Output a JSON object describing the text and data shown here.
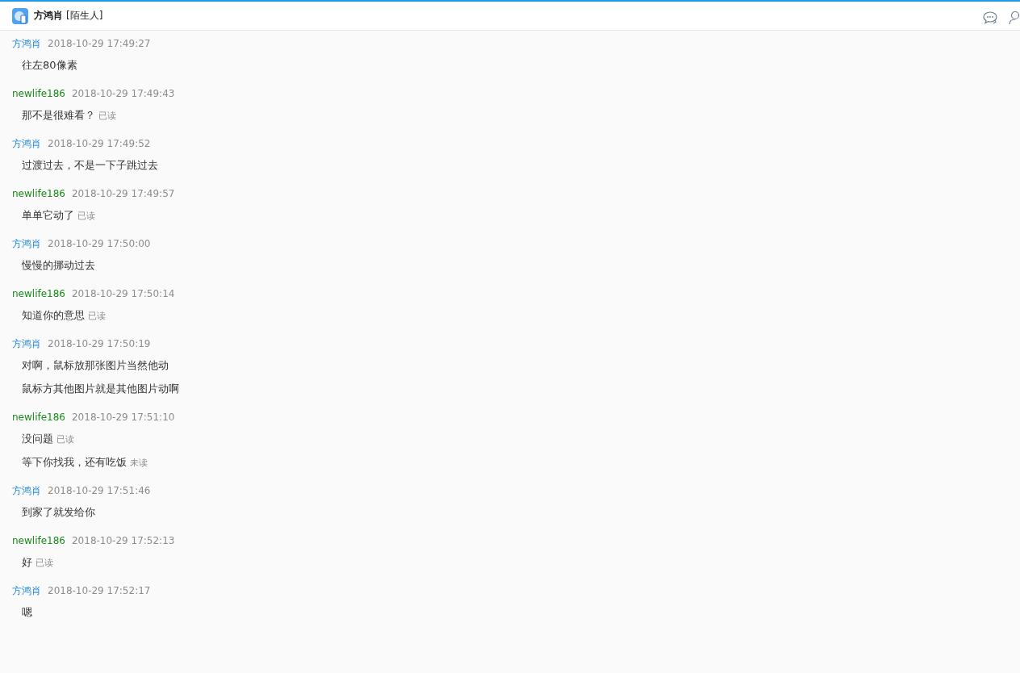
{
  "header": {
    "name": "方鸿肖",
    "tag": "[陌生人]"
  },
  "messages": [
    {
      "sender": "方鸿肖",
      "kind": "contact",
      "time": "2018-10-29 17:49:27",
      "lines": [
        {
          "text": "往左80像素"
        }
      ]
    },
    {
      "sender": "newlife186",
      "kind": "self",
      "time": "2018-10-29 17:49:43",
      "lines": [
        {
          "text": "那不是很难看？",
          "status": "已读"
        }
      ]
    },
    {
      "sender": "方鸿肖",
      "kind": "contact",
      "time": "2018-10-29 17:49:52",
      "lines": [
        {
          "text": "过渡过去，不是一下子跳过去"
        }
      ]
    },
    {
      "sender": "newlife186",
      "kind": "self",
      "time": "2018-10-29 17:49:57",
      "lines": [
        {
          "text": "单单它动了",
          "status": "已读"
        }
      ]
    },
    {
      "sender": "方鸿肖",
      "kind": "contact",
      "time": "2018-10-29 17:50:00",
      "lines": [
        {
          "text": "慢慢的挪动过去"
        }
      ]
    },
    {
      "sender": "newlife186",
      "kind": "self",
      "time": "2018-10-29 17:50:14",
      "lines": [
        {
          "text": "知道你的意思",
          "status": "已读"
        }
      ]
    },
    {
      "sender": "方鸿肖",
      "kind": "contact",
      "time": "2018-10-29 17:50:19",
      "lines": [
        {
          "text": "对啊，鼠标放那张图片当然他动"
        },
        {
          "text": "鼠标方其他图片就是其他图片动啊"
        }
      ]
    },
    {
      "sender": "newlife186",
      "kind": "self",
      "time": "2018-10-29 17:51:10",
      "lines": [
        {
          "text": "没问题",
          "status": "已读"
        },
        {
          "text": "等下你找我，还有吃饭",
          "status": "未读"
        }
      ]
    },
    {
      "sender": "方鸿肖",
      "kind": "contact",
      "time": "2018-10-29 17:51:46",
      "lines": [
        {
          "text": "到家了就发给你"
        }
      ]
    },
    {
      "sender": "newlife186",
      "kind": "self",
      "time": "2018-10-29 17:52:13",
      "lines": [
        {
          "text": "好",
          "status": "已读"
        }
      ]
    },
    {
      "sender": "方鸿肖",
      "kind": "contact",
      "time": "2018-10-29 17:52:17",
      "lines": [
        {
          "text": "嗯"
        }
      ]
    }
  ]
}
